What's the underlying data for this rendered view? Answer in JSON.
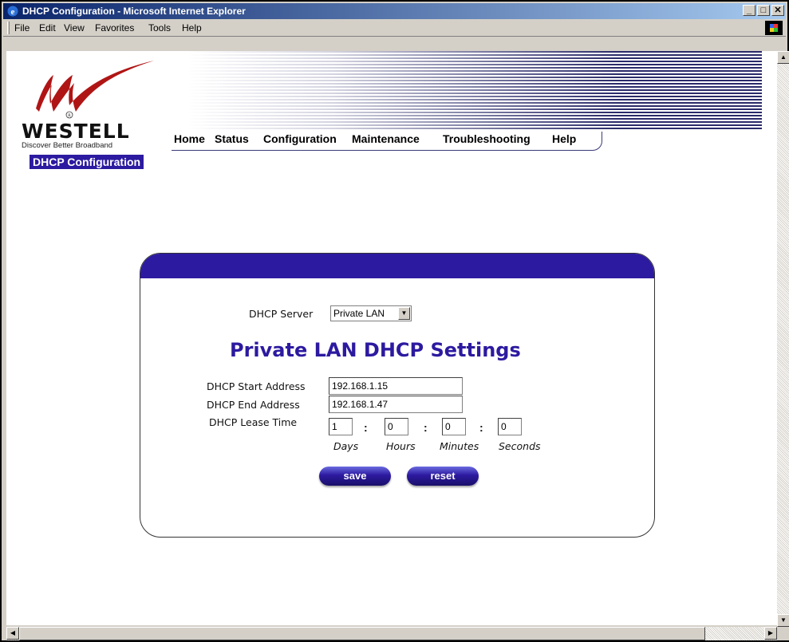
{
  "window": {
    "title": "DHCP Configuration - Microsoft Internet Explorer",
    "controls": [
      "_",
      "□",
      "✕"
    ]
  },
  "menubar": {
    "items": [
      "File",
      "Edit",
      "View",
      "Favorites",
      "Tools",
      "Help"
    ]
  },
  "brand": {
    "name": "WESTELL",
    "tagline": "Discover  Better Broadband"
  },
  "nav": {
    "items": [
      "Home",
      "Status",
      "Configuration",
      "Maintenance",
      "Troubleshooting",
      "Help"
    ]
  },
  "page_tag": "DHCP Configuration",
  "form": {
    "server_label": "DHCP Server",
    "server_value": "Private LAN",
    "heading": "Private LAN DHCP Settings",
    "start_label": "DHCP Start Address",
    "start_value": "192.168.1.15",
    "end_label": "DHCP End Address",
    "end_value": "192.168.1.47",
    "lease_label": "DHCP Lease Time",
    "lease": {
      "days": "1",
      "hours": "0",
      "minutes": "0",
      "seconds": "0"
    },
    "units": {
      "days": "Days",
      "hours": "Hours",
      "minutes": "Minutes",
      "seconds": "Seconds"
    },
    "save_label": "save",
    "reset_label": "reset"
  },
  "colors": {
    "brand_blue": "#2c1aa0",
    "titlebar": "#0a246a"
  }
}
